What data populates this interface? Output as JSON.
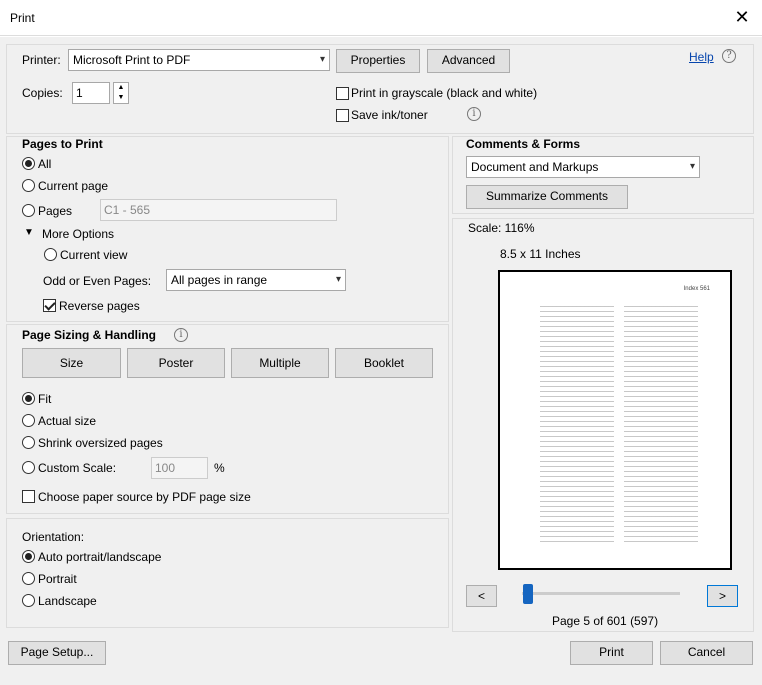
{
  "window": {
    "title": "Print",
    "close_glyph": "✕"
  },
  "printer": {
    "label": "Printer:",
    "value": "Microsoft Print to PDF",
    "properties_label": "Properties",
    "advanced_label": "Advanced",
    "help_label": "Help"
  },
  "copies": {
    "label": "Copies:",
    "value": "1"
  },
  "options": {
    "grayscale_label": "Print in grayscale (black and white)",
    "save_ink_label": "Save ink/toner"
  },
  "pages_to_print": {
    "heading": "Pages to Print",
    "all_label": "All",
    "current_page_label": "Current page",
    "pages_label": "Pages",
    "pages_value": "C1 - 565",
    "more_options_label": "More Options",
    "current_view_label": "Current view",
    "odd_even_label": "Odd or Even Pages:",
    "odd_even_value": "All pages in range",
    "reverse_label": "Reverse pages"
  },
  "sizing": {
    "heading": "Page Sizing & Handling",
    "tabs": {
      "size": "Size",
      "poster": "Poster",
      "multiple": "Multiple",
      "booklet": "Booklet"
    },
    "fit_label": "Fit",
    "actual_size_label": "Actual size",
    "shrink_label": "Shrink oversized pages",
    "custom_scale_label": "Custom Scale:",
    "custom_scale_value": "100",
    "percent": "%",
    "paper_source_label": "Choose paper source by PDF page size"
  },
  "orientation": {
    "heading": "Orientation:",
    "auto_label": "Auto portrait/landscape",
    "portrait_label": "Portrait",
    "landscape_label": "Landscape"
  },
  "comments": {
    "heading": "Comments & Forms",
    "value": "Document and Markups",
    "summarize_label": "Summarize Comments"
  },
  "preview": {
    "scale": "Scale: 116%",
    "paper": "8.5 x 11 Inches",
    "page_header": "Index 561",
    "prev": "<",
    "next": ">",
    "page_status": "Page 5 of 601 (597)",
    "slider_fraction": 0.008
  },
  "footer": {
    "page_setup_label": "Page Setup...",
    "print_label": "Print",
    "cancel_label": "Cancel"
  }
}
